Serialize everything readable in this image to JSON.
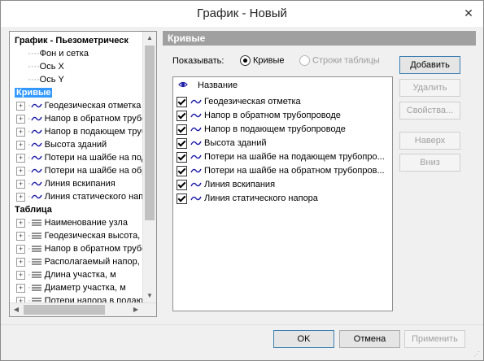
{
  "window": {
    "title": "График - Новый",
    "close_glyph": "✕"
  },
  "tree": {
    "items": [
      {
        "label": "График - Пьезометрическ",
        "kind": "root",
        "bold": true
      },
      {
        "label": "Фон и сетка",
        "kind": "leaf"
      },
      {
        "label": "Ось X",
        "kind": "leaf"
      },
      {
        "label": "Ось Y",
        "kind": "leaf"
      },
      {
        "label": "Кривые",
        "kind": "root",
        "bold": true,
        "selected": true
      },
      {
        "label": "Геодезическая отметка",
        "kind": "curve"
      },
      {
        "label": "Напор в обратном трубоп",
        "kind": "curve"
      },
      {
        "label": "Напор в подающем трубоп",
        "kind": "curve"
      },
      {
        "label": "Высота зданий",
        "kind": "curve"
      },
      {
        "label": "Потери на шайбе на пода",
        "kind": "curve"
      },
      {
        "label": "Потери на шайбе на обрат",
        "kind": "curve"
      },
      {
        "label": "Линия вскипания",
        "kind": "curve"
      },
      {
        "label": "Линия статического напор",
        "kind": "curve"
      },
      {
        "label": "Таблица",
        "kind": "root",
        "bold": true
      },
      {
        "label": "Наименование узла",
        "kind": "column"
      },
      {
        "label": "Геодезическая высота,",
        "kind": "column"
      },
      {
        "label": "Напор в обратном трубо",
        "kind": "column"
      },
      {
        "label": "Располагаемый напор,",
        "kind": "column"
      },
      {
        "label": "Длина участка, м",
        "kind": "column"
      },
      {
        "label": "Диаметр участка, м",
        "kind": "column"
      },
      {
        "label": "Потери напора в подаю",
        "kind": "column"
      }
    ],
    "scroll_up": "▲",
    "scroll_down": "▼",
    "scroll_left": "◀",
    "scroll_right": "▶"
  },
  "panel": {
    "header": "Кривые",
    "show_label": "Показывать:",
    "radio_curves": "Кривые",
    "radio_rows": "Строки таблицы",
    "column_name": "Название",
    "curves": [
      {
        "label": "Геодезическая отметка",
        "checked": true
      },
      {
        "label": "Напор в обратном трубопроводе",
        "checked": true
      },
      {
        "label": "Напор в подающем трубопроводе",
        "checked": true
      },
      {
        "label": "Высота зданий",
        "checked": true
      },
      {
        "label": "Потери на шайбе на подающем трубопро...",
        "checked": true
      },
      {
        "label": "Потери на шайбе на обратном трубопров...",
        "checked": true
      },
      {
        "label": "Линия вскипания",
        "checked": true
      },
      {
        "label": "Линия статического напора",
        "checked": true
      }
    ],
    "buttons": {
      "add": "Добавить",
      "delete": "Удалить",
      "properties": "Свойства...",
      "up": "Наверх",
      "down": "Вниз"
    }
  },
  "footer": {
    "ok": "OK",
    "cancel": "Отмена",
    "apply": "Применить"
  },
  "colors": {
    "selection": "#3399ff",
    "header_bg": "#a0a0a0",
    "curve_wave": "#1a1aa6"
  }
}
